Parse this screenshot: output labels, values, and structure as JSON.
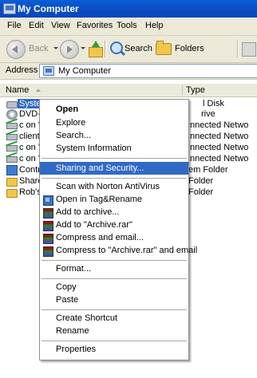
{
  "window": {
    "title": "My Computer"
  },
  "menu": [
    "File",
    "Edit",
    "View",
    "Favorites",
    "Tools",
    "Help"
  ],
  "toolbar": {
    "back": "Back",
    "search": "Search",
    "folders": "Folders"
  },
  "address": {
    "label": "Address",
    "value": "My Computer"
  },
  "columns": {
    "name": "Name",
    "type": "Type"
  },
  "items": [
    {
      "name": "System (C:)",
      "type": "Local Disk",
      "icon": "drive-icon"
    },
    {
      "name": "DVD-RW Drive (D:)",
      "type": "CD Drive",
      "icon": "dvd-drive-icon"
    },
    {
      "name": "c on 's",
      "type": "Disconnected Network Drive",
      "icon": "network-drive-icon"
    },
    {
      "name": "clients",
      "type": "Disconnected Network Drive",
      "icon": "network-drive-icon"
    },
    {
      "name": "c on 'r",
      "type": "Disconnected Network Drive",
      "icon": "network-drive-icon"
    },
    {
      "name": "c on 'k",
      "type": "Disconnected Network Drive",
      "icon": "network-drive-icon"
    },
    {
      "name": "Control Panel",
      "type": "System Folder",
      "icon": "control-panel-icon"
    },
    {
      "name": "Shared Documents",
      "type": "File Folder",
      "icon": "folder-icon"
    },
    {
      "name": "Rob's Documents",
      "type": "File Folder",
      "icon": "folder-icon"
    }
  ],
  "visible_names": [
    "System",
    "DVD-R",
    "c on 's",
    "clients",
    "c on 'r",
    "c on 'k",
    "Contr",
    "Share",
    "Rob's"
  ],
  "visible_types": [
    "l Disk",
    "rive",
    "nnected Netwo",
    "nnected Netwo",
    "nnected Netwo",
    "nnected Netwo",
    "em Folder",
    "Folder",
    "Folder"
  ],
  "context_menu": {
    "open": "Open",
    "explore": "Explore",
    "search": "Search...",
    "system_information": "System Information",
    "sharing_and_security": "Sharing and Security...",
    "scan_norton": "Scan with Norton AntiVirus",
    "open_tag": "Open in Tag&Rename",
    "add_archive": "Add to archive...",
    "add_archive_rar": "Add to \"Archive.rar\"",
    "compress_email": "Compress and email...",
    "compress_rar_email": "Compress to \"Archive.rar\" and email",
    "format": "Format...",
    "copy": "Copy",
    "paste": "Paste",
    "create_shortcut": "Create Shortcut",
    "rename": "Rename",
    "properties": "Properties"
  },
  "colors": {
    "titlebar": "#0a5fd9",
    "selection": "#316ac5",
    "chrome": "#ece9d8"
  }
}
